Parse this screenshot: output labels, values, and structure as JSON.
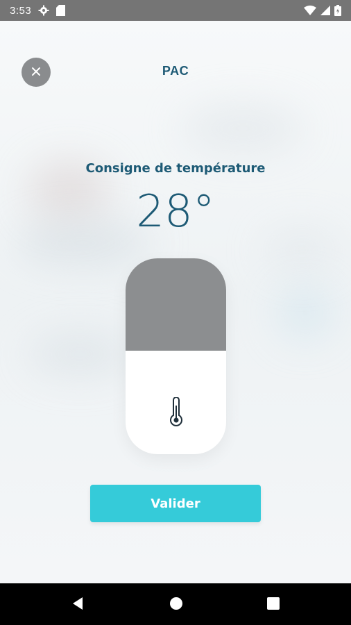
{
  "status_bar": {
    "time": "3:53",
    "icons_left": [
      "settings-icon",
      "sd-card-icon"
    ],
    "icons_right": [
      "wifi-icon",
      "signal-icon",
      "battery-icon"
    ]
  },
  "header": {
    "title": "PAC",
    "close_icon": "close-icon"
  },
  "setpoint": {
    "label": "Consigne de température",
    "value": "28°",
    "slider_level": 0.47
  },
  "actions": {
    "validate_label": "Valider"
  },
  "colors": {
    "accent": "#35cbd9",
    "title": "#1d5a75",
    "slider_fill": "#8c8e90"
  },
  "navigation": {
    "buttons": [
      "back-icon",
      "home-icon",
      "recents-icon"
    ]
  }
}
